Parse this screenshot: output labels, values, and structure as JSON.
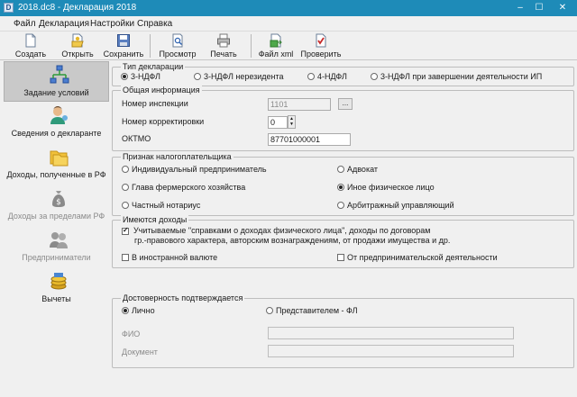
{
  "window": {
    "app_icon_letter": "D",
    "title": "2018.dc8 - Декларация 2018",
    "min_glyph": "–",
    "max_glyph": "☐",
    "close_glyph": "✕"
  },
  "menu": [
    "Файл",
    "Декларация",
    "Настройки",
    "Справка"
  ],
  "toolbar": {
    "create": "Создать",
    "open": "Открыть",
    "save": "Сохранить",
    "preview": "Просмотр",
    "print": "Печать",
    "xml": "Файл xml",
    "check": "Проверить"
  },
  "sidebar": {
    "items": [
      {
        "label": "Задание условий",
        "state": "active"
      },
      {
        "label": "Сведения о декларанте",
        "state": "normal"
      },
      {
        "label": "Доходы, полученные в РФ",
        "state": "normal"
      },
      {
        "label": "Доходы за пределами РФ",
        "state": "disabled"
      },
      {
        "label": "Предприниматели",
        "state": "disabled"
      },
      {
        "label": "Вычеты",
        "state": "normal"
      }
    ]
  },
  "declaration_type": {
    "title": "Тип декларации",
    "options": [
      "3-НДФЛ",
      "3-НДФЛ нерезидента",
      "4-НДФЛ",
      "3-НДФЛ при завершении деятельности ИП"
    ],
    "selected": "3-НДФЛ"
  },
  "general_info": {
    "title": "Общая информация",
    "inspection_label": "Номер инспекции",
    "inspection_value": "1101",
    "browse_label": "...",
    "correction_label": "Номер корректировки",
    "correction_value": "0",
    "spin_up": "▲",
    "spin_down": "▼",
    "oktmo_label": "ОКТМО",
    "oktmo_value": "87701000001"
  },
  "taxpayer_sign": {
    "title": "Признак налогоплательщика",
    "options": [
      "Индивидуальный предприниматель",
      "Адвокат",
      "Глава фермерского хозяйства",
      "Иное физическое лицо",
      "Частный нотариус",
      "Арбитражный управляющий"
    ],
    "selected": "Иное физическое лицо"
  },
  "income": {
    "title": "Имеются доходы",
    "certified_line1": "Учитываемые \"справками о доходах физического лица\", доходы по договорам",
    "certified_line2": "гр.-правового характера, авторским вознаграждениям, от продажи имущества и др.",
    "certified_checked": true,
    "foreign": "В иностранной валюте",
    "foreign_checked": false,
    "business": "От предпринимательской деятельности",
    "business_checked": false
  },
  "reliability": {
    "title": "Достоверность подтверждается",
    "options": [
      "Лично",
      "Представителем - ФЛ"
    ],
    "selected": "Лично",
    "fio_label": "ФИО",
    "fio_value": "",
    "document_label": "Документ",
    "document_value": ""
  },
  "colors": {
    "titlebar": "#1e8bb8",
    "window_bg": "#f0f0f0",
    "active_item": "#c9c9c9"
  }
}
